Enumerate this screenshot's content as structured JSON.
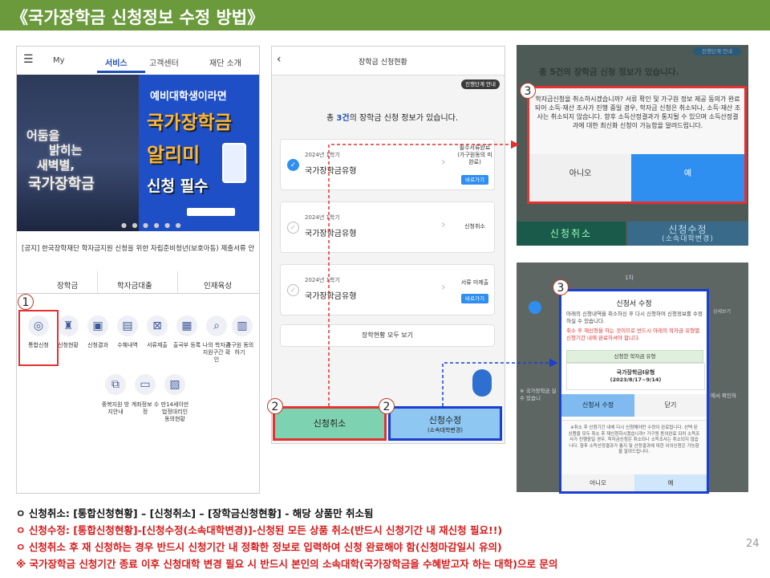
{
  "title": "《국가장학금 신청정보 수정 방법》",
  "phone1": {
    "menu_icon": "hamburger-icon",
    "nav": [
      "My",
      "서비스",
      "고객센터",
      "재단 소개"
    ],
    "banner_left": {
      "line1": "어둠을",
      "line2": "밝히는",
      "line3": "새벽별,",
      "line4": "국가장학금"
    },
    "banner_right": {
      "line1": "예비대학생이라면",
      "line2": "국가장학금",
      "line3": "알리미",
      "line4": "신청 필수"
    },
    "notice": "[공지] 한국장학재단 학자금지원 신청을 위한 자립준비청년(보호아동) 제출서류 안내",
    "tabs": [
      "장학금",
      "학자금대출",
      "인재육성"
    ],
    "icons_row1": [
      "통합신청",
      "신청현황",
      "신청결과",
      "수혜내역",
      "서류제출",
      "출국부 등록",
      "나의 학자금 지원구간 확인",
      "가구원 동의하기"
    ],
    "icons_row2": [
      "중복지원 방지안내",
      "계좌정보 수정",
      "만14세이만 법정대리인 동의현황"
    ]
  },
  "phone2": {
    "back_icon": "chevron-left-icon",
    "header": "장학금 신청현황",
    "guide_badge": "진행단계 안내",
    "summary_pre": "총 ",
    "summary_count": "3건",
    "summary_post": "의 장학금 신청 정보가 있습니다.",
    "cards": [
      {
        "year": "2024년 1학기",
        "name": "국가장학금유형",
        "status": "필수서류완료 (가구원동의 미완료)",
        "button": "바로가기",
        "checked": true
      },
      {
        "year": "2024년 1학기",
        "name": "국가장학금유형",
        "status": "신청취소",
        "button": "",
        "checked": false
      },
      {
        "year": "2024년 1학기",
        "name": "국가장학금유형",
        "status": "서류 미제출",
        "button": "바로가기",
        "checked": false
      }
    ],
    "view_all": "장학현황 모두 보기",
    "cancel_button": "신청취소",
    "modify_button_line1": "신청수정",
    "modify_button_line2": "(소속대학변경)"
  },
  "badges": {
    "step1": "1",
    "step2": "2",
    "step3": "3"
  },
  "dialog_cancel": {
    "bg_guide": "진행단계 안내",
    "bg_summary": "총 5건의 장학금 신청 정보가 있습니다.",
    "body": "학자금신청을 취소하시겠습니까? 서류 확인 및 가구원 정보 제공 동의가 완료되어 소득·재산 조사가 진행 중일 경우, 학자금 신청은 취소되나, 소득·재산 조사는 취소되지 않습니다. 향후 소득산정결과가 통지될 수 있으며 소득산정결과에 대한 최신화 신청이 가능함을 알려드립니다.",
    "no": "아니오",
    "yes": "예",
    "bg_cancel": "신청취소",
    "bg_modify_line1": "신청수정",
    "bg_modify_line2": "(소속대학변경)"
  },
  "dialog_modify": {
    "bg_term": "1차",
    "bg_side": "상세보기",
    "bg_bottom_left": "※ 국가장학금 실 수 있습니",
    "bg_bottom_right": "에서 확인하",
    "title": "신청서 수정",
    "desc": "아래의 신청내역을 취소하신 후 다시 신청하여 신청정보를 수정하실 수 있습니다.",
    "warn": "취소 후 재신청을 하는 것이므로 반드시 아래의 학자금 유형별 신청기간 내에 완료하셔야 합니다.",
    "type_header": "신청한 학자금 유형",
    "type_name": "국가장학금I유형",
    "type_period": "(2023/8/17~9/14)",
    "modify_button": "신청서 수정",
    "close_button": "닫기",
    "confirm_text": "※취소 후 신청기간 내에 다시 신청해야만 수정이 완료됩니다. 선택 된 상품을 모두 취소 후 재신청하시겠습니까? 가구원 동의완료 되어 소득조사가 진행중일 경우, 학자금신청은 취소되나 소득조사는 취소되지 않습니다. 향후 소득산정결과가 통지 및 산정결과에 대한 이의신청은 가능함을 알려드립니다.",
    "no": "아니오",
    "yes": "예"
  },
  "notes": {
    "n1": "ㅇ 신청취소: [통합신청현황] – [신청취소] – [장학금신청현황] - 해당 상품만 취소됨",
    "n2": "ㅇ 신청수정: [통합신청현황]-[신청수정(소속대학변경)]-신청된 모든 상품 취소(반드시 신청기간 내 재신청 필요!!)",
    "n3": "ㅇ 신청취소 후 재 신청하는 경우 반드시 신청기간 내 정확한 정보로 입력하여 신청 완료해야 함(신청마감일시 유의)",
    "n4": "※ 국가장학금 신청기간 종료 이후 신청대학 변경 필요 시 반드시 본인의 소속대학(국가장학금을 수혜받고자 하는 대학)으로 문의"
  },
  "page_number": "24",
  "colors": {
    "title_bar": "#6a9a3c",
    "highlight_red": "#e23232",
    "highlight_blue": "#1a3fd1",
    "accent_blue": "#2f8ff0"
  }
}
